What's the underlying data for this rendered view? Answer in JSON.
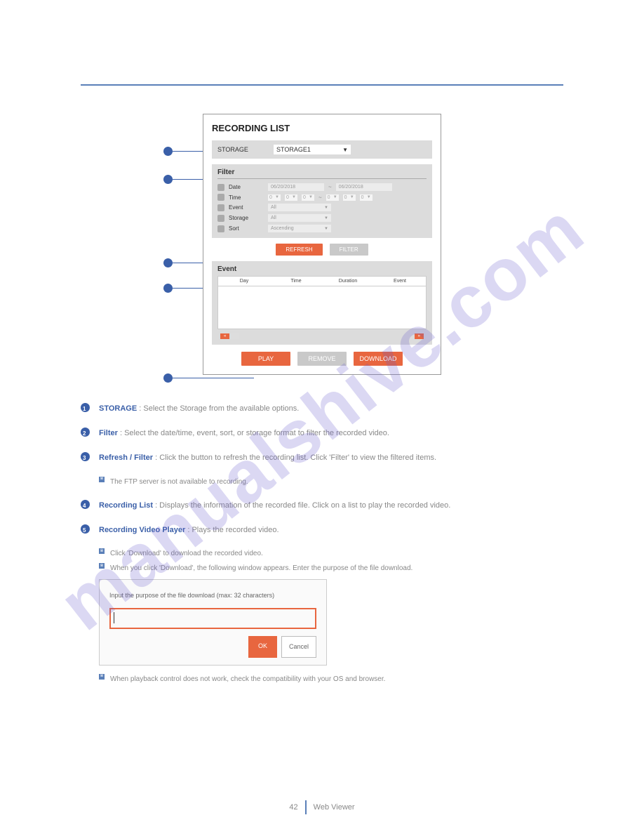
{
  "panel": {
    "title": "RECORDING LIST",
    "storage_label": "STORAGE",
    "storage_value": "STORAGE1",
    "filter_label": "Filter",
    "rows": [
      {
        "name": "Date",
        "from": "06/20/2018",
        "to": "06/20/2018"
      },
      {
        "name": "Time"
      },
      {
        "name": "Event",
        "val": "All"
      },
      {
        "name": "Storage",
        "val": "All"
      },
      {
        "name": "Sort",
        "val": "Ascending"
      }
    ],
    "time_val": "0",
    "refresh": "REFRESH",
    "filter_btn": "FILTER",
    "event_label": "Event",
    "cols": {
      "c1": "Day",
      "c2": "Time",
      "c3": "Duration",
      "c4": "Event"
    },
    "play": "PLAY",
    "remove": "REMOVE",
    "download": "DOWNLOAD"
  },
  "items": {
    "i1": {
      "t": "STORAGE",
      "d": " : Select the Storage from the available options."
    },
    "i2": {
      "t": "Filter",
      "d": " : Select the date/time, event, sort, or storage format to filter the recorded video."
    },
    "i3": {
      "t": "Refresh / Filter",
      "d": " : Click the button to refresh the recording list. Click 'Filter' to view the filtered items."
    },
    "i3s": "The FTP server is not available to recording.",
    "i4": {
      "t": "Recording List",
      "d": " : Displays the information of the recorded file. Click on a list to play the recorded video."
    },
    "i5": {
      "t": "Recording Video Player",
      "d": " : Plays the recorded video."
    },
    "i5s1": "Click 'Download' to download the recorded video.",
    "i5s2": "When you click 'Download', the following window appears. Enter the purpose of the file download.",
    "i5s3": "When playback control does not work, check the compatibility with your OS and browser."
  },
  "dialog": {
    "label": "Input the purpose of the file download (max: 32 characters)",
    "ok": "OK",
    "cancel": "Cancel"
  },
  "footer": {
    "left": "42",
    "right": " Web Viewer"
  },
  "watermark": "manualshive.com"
}
